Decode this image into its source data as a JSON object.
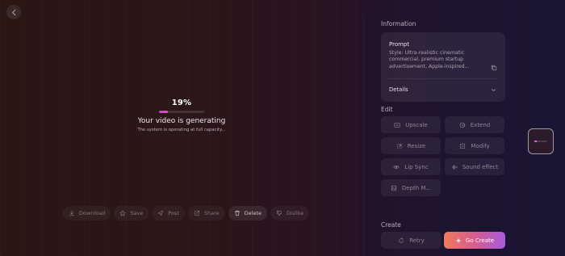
{
  "progress": {
    "percent_label": "19%",
    "percent_value": 19,
    "title": "Your video is generating",
    "subtitle": "The system is operating at full capacity..."
  },
  "actions": [
    {
      "label": "Download",
      "icon": "download-icon"
    },
    {
      "label": "Save",
      "icon": "star-icon"
    },
    {
      "label": "Post",
      "icon": "send-icon"
    },
    {
      "label": "Share",
      "icon": "share-icon"
    },
    {
      "label": "Delete",
      "icon": "trash-icon"
    },
    {
      "label": "Dislike",
      "icon": "thumbs-down-icon"
    }
  ],
  "sidebar": {
    "information_title": "Information",
    "prompt_label": "Prompt",
    "prompt_text": "Style: Ultra-realistic cinematic commercial, premium startup advertisement, Apple-inspired...",
    "details_label": "Details",
    "edit_title": "Edit",
    "edit_buttons": [
      {
        "label": "Upscale",
        "icon": "upscale-icon"
      },
      {
        "label": "Extend",
        "icon": "extend-icon"
      },
      {
        "label": "Resize",
        "icon": "resize-icon"
      },
      {
        "label": "Modify",
        "icon": "modify-icon"
      },
      {
        "label": "Lip Sync",
        "icon": "eye-icon"
      },
      {
        "label": "Sound effect",
        "icon": "waveform-icon"
      },
      {
        "label": "Depth M...",
        "icon": "depth-icon"
      }
    ],
    "create_title": "Create",
    "retry_label": "Retry",
    "go_create_label": "Go Create"
  },
  "colors": {
    "accent_gradient_start": "#ef7a5c",
    "accent_gradient_end": "#a45be0",
    "progress_fill": "#d14fcf"
  }
}
